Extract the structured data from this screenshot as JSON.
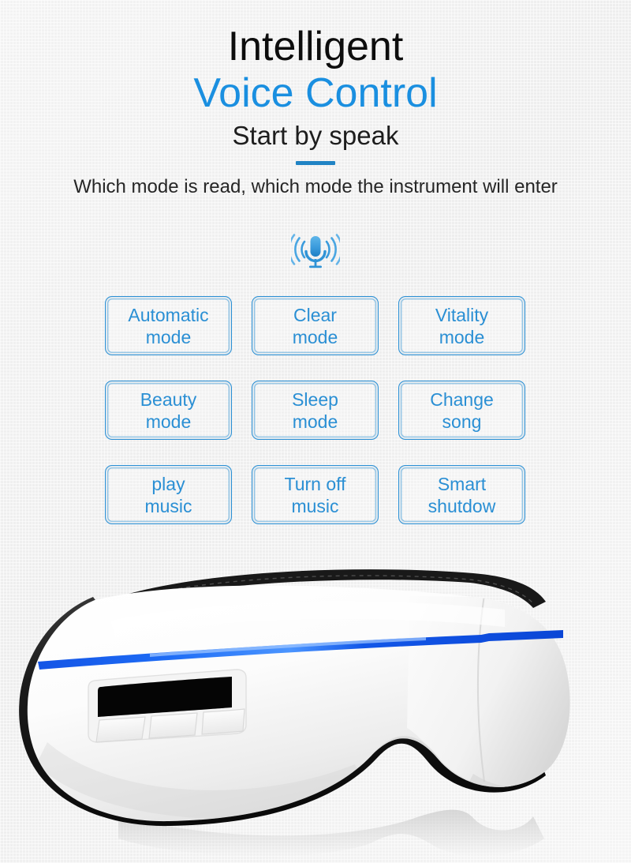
{
  "header": {
    "title_line1": "Intelligent",
    "title_line2": "Voice Control",
    "subtitle": "Start by speak",
    "tagline": "Which mode is read, which mode\nthe instrument will enter"
  },
  "icons": {
    "microphone": "microphone-icon"
  },
  "colors": {
    "accent_blue": "#1a8fe0",
    "button_blue": "#2a8fd4",
    "divider_blue": "#2083c4",
    "title_black": "#0d0d0d",
    "background": "#f1f1f1",
    "device_stripe_blue": "#0a52e8"
  },
  "voice_commands": [
    {
      "label": "Automatic\nmode",
      "name": "automatic-mode"
    },
    {
      "label": "Clear\nmode",
      "name": "clear-mode"
    },
    {
      "label": "Vitality\nmode",
      "name": "vitality-mode"
    },
    {
      "label": "Beauty\nmode",
      "name": "beauty-mode"
    },
    {
      "label": "Sleep\nmode",
      "name": "sleep-mode"
    },
    {
      "label": "Change\nsong",
      "name": "change-song"
    },
    {
      "label": "play\nmusic",
      "name": "play-music"
    },
    {
      "label": "Turn off\nmusic",
      "name": "turn-off-music"
    },
    {
      "label": "Smart\nshutdow",
      "name": "smart-shutdown"
    }
  ],
  "product": {
    "name": "eye-massager-device",
    "alt": "White eye massager with black padded edge, blue accent stripe, black LCD display and three control buttons"
  }
}
